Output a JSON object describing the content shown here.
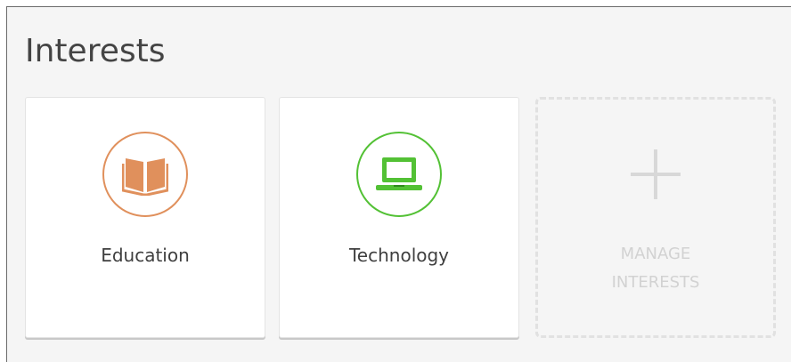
{
  "section": {
    "title": "Interests"
  },
  "interests": [
    {
      "label": "Education",
      "icon": "book-icon",
      "color": "#e0905c"
    },
    {
      "label": "Technology",
      "icon": "laptop-icon",
      "color": "#53c135"
    }
  ],
  "manage": {
    "line1": "MANAGE",
    "line2": "INTERESTS",
    "icon": "plus-icon"
  }
}
